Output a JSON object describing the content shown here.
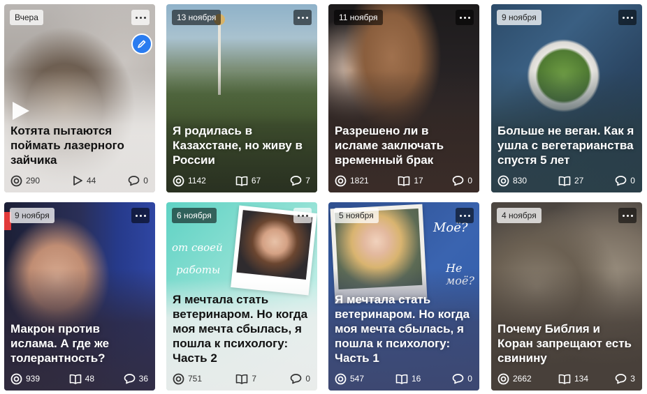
{
  "cards": [
    {
      "date": "Вчера",
      "title": "Котята пытаются поймать лазерного зайчика",
      "views": "290",
      "mid": "44",
      "mid_icon": "play-icon",
      "comments": "0",
      "has_edit": true,
      "has_play": true
    },
    {
      "date": "13 ноября",
      "title": "Я родилась в Казахстане, но живу в России",
      "views": "1142",
      "mid": "67",
      "mid_icon": "book-icon",
      "comments": "7"
    },
    {
      "date": "11 ноября",
      "title": "Разрешено ли в исламе заключать временный брак",
      "views": "1821",
      "mid": "17",
      "mid_icon": "book-icon",
      "comments": "0"
    },
    {
      "date": "9 ноября",
      "title": "Больше не веган. Как я ушла с вегетарианства спустя 5 лет",
      "views": "830",
      "mid": "27",
      "mid_icon": "book-icon",
      "comments": "0"
    },
    {
      "date": "9 ноября",
      "title": "Макрон против ислама. А где же толерантность?",
      "views": "939",
      "mid": "48",
      "mid_icon": "book-icon",
      "comments": "36"
    },
    {
      "date": "6 ноября",
      "title": "Я мечтала стать ветеринаром. Но когда моя мечта сбылась, я пошла к психологу: Часть 2",
      "views": "751",
      "mid": "7",
      "mid_icon": "book-icon",
      "comments": "0",
      "image_text_1": "от своей",
      "image_text_2": "работы"
    },
    {
      "date": "5 ноября",
      "title": "Я мечтала стать ветеринаром. Но когда моя мечта сбылась, я пошла к психологу: Часть 1",
      "views": "547",
      "mid": "16",
      "mid_icon": "book-icon",
      "comments": "0",
      "image_text_1": "Моё?",
      "image_text_2": "Не моё?"
    },
    {
      "date": "4 ноября",
      "title": "Почему Библия и Коран запрещают есть свинину",
      "views": "2662",
      "mid": "134",
      "mid_icon": "book-icon",
      "comments": "3"
    }
  ]
}
